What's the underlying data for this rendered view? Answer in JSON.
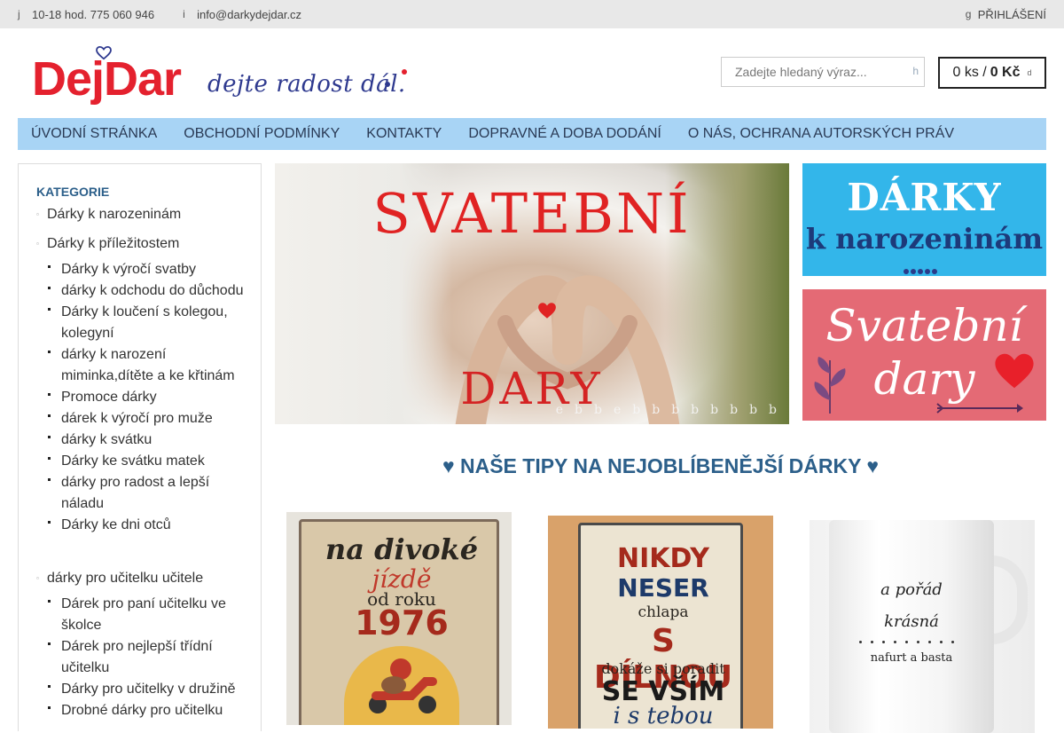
{
  "topbar": {
    "phone_icon": "j",
    "hours_phone": "10-18 hod. 775 060 946",
    "mail_icon": "i",
    "email": "info@darkydejdar.cz",
    "login_icon": "g",
    "login": "PŘIHLÁŠENÍ"
  },
  "logo": {
    "main": "DejDar",
    "tagline": "dejte radost dál."
  },
  "search": {
    "placeholder": "Zadejte hledaný výraz...",
    "button_glyph": "h"
  },
  "cart": {
    "count": "0 ks /",
    "price": "0 Kč",
    "icon_glyph": "d"
  },
  "nav": {
    "items": [
      "ÚVODNÍ STRÁNKA",
      "OBCHODNÍ PODMÍNKY",
      "KONTAKTY",
      "DOPRAVNÉ A DOBA DODÁNÍ",
      "O NÁS, OCHRANA AUTORSKÝCH PRÁV"
    ]
  },
  "sidebar": {
    "title": "KATEGORIE",
    "categories": [
      {
        "label": "Dárky k narozeninám"
      },
      {
        "label": "Dárky k příležitostem"
      },
      {
        "label": "dárky pro učitelku učitele"
      }
    ],
    "sub_occasions": [
      "Dárky k výročí svatby",
      "dárky k odchodu do důchodu",
      "Dárky k loučení s kolegou, kolegyní",
      "dárky k narození miminka,dítěte a ke křtinám",
      "Promoce dárky",
      "dárek k výročí pro muže",
      "dárky k svátku",
      "Dárky ke svátku matek",
      "dárky pro radost a lepší náladu",
      "Dárky ke dni otců"
    ],
    "sub_teachers": [
      "Dárek pro paní učitelku ve školce",
      "Dárek pro nejlepší třídní učitelku",
      "Dárky pro učitelky v družině",
      "Drobné dárky pro učitelku"
    ],
    "bullet_color": "#222222"
  },
  "slider": {
    "title_top": "SVATEBNÍ",
    "title_bottom": "DARY",
    "dots": [
      "e",
      "b",
      "b",
      "e",
      "b",
      "b",
      "b",
      "b",
      "b",
      "b",
      "b",
      "b"
    ],
    "accent": "#e02323"
  },
  "banner_birthday": {
    "line1": "DÁRKY",
    "line2": "k narozeninám",
    "bg": "#33b6ea"
  },
  "banner_wedding": {
    "line1": "Svatební",
    "line2": "dary",
    "bg": "#e46a75"
  },
  "tips": {
    "heading": "♥ NAŠE TIPY NA NEJOBLÍBENĚJŠÍ DÁRKY ♥"
  },
  "products": [
    {
      "lines": [
        "na divoké",
        "jízdě",
        "od roku",
        "1976"
      ]
    },
    {
      "lines": [
        "NIKDY",
        "NESER",
        "chlapa",
        "S DÍLNOU",
        "dokáže si poradit",
        "SE VŠÍM",
        "i s tebou"
      ]
    },
    {
      "lines": [
        "a pořád",
        "krásná",
        "nafurt a basta"
      ]
    }
  ],
  "colors": {
    "nav_bg": "#a8d4f5",
    "brand_red": "#e4212e",
    "brand_blue": "#2f3a8f",
    "link_blue": "#2c5f8a",
    "topbar_bg": "#e8e8e8"
  }
}
